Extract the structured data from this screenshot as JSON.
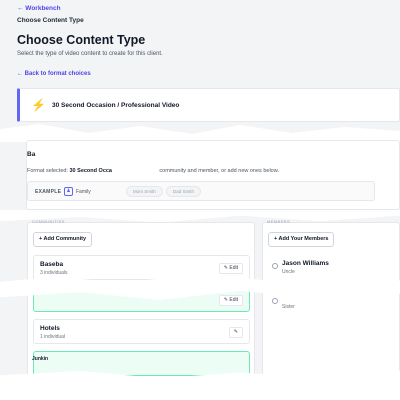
{
  "breadcrumbs": {
    "back_label": "← Workbench",
    "current_label": "Choose Content Type"
  },
  "header": {
    "title": "Choose Content Type",
    "subtitle": "Select the type of video content to create for this client.",
    "back_link": "← Back to format choices"
  },
  "format": {
    "icon": "lightning-bolt-icon",
    "icon_glyph": "⚡",
    "name": "30 Second Occasion / Professional Video"
  },
  "assignment": {
    "heading_fragment": "Ba",
    "selected_prefix": "Format selected:",
    "selected_format": "30 Second Occa",
    "selected_suffix": "community and member, or add new ones below.",
    "example_label": "EXAMPLE",
    "example_icon_glyph": "👥",
    "example_group": "Family",
    "example_chips": [
      "Mom Smith",
      "Dad Smith"
    ]
  },
  "communities": {
    "section_label": "COMMUNITIES",
    "add_button": "+ Add Community",
    "items": [
      {
        "name": "Baseba",
        "count": "3 individuals",
        "edit": "✎ Edit"
      },
      {
        "name": "",
        "count": "",
        "edit": "✎ Edit"
      },
      {
        "name": "Hotels",
        "count": "1 individual",
        "edit": "✎"
      }
    ],
    "cut_off_label": "Junkin"
  },
  "members": {
    "section_label": "MEMBERS",
    "add_button": "+ Add Your Members",
    "items": [
      {
        "name": "Jason Williams",
        "role": "Uncle"
      },
      {
        "name": "",
        "role": "Sister"
      }
    ]
  },
  "colors": {
    "accent": "#4f46e5",
    "format_border": "#6366f1",
    "bolt": "#f59e0b",
    "selected_bg": "#ecfdf5",
    "selected_border": "#6ee7b7"
  }
}
